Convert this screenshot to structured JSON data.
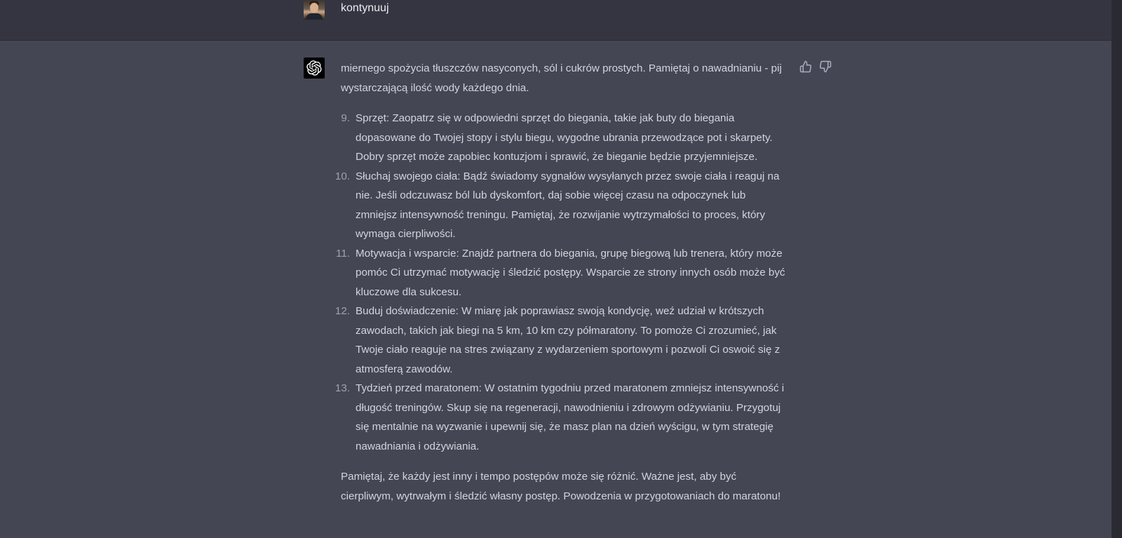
{
  "user_message": {
    "text": "kontynuuj"
  },
  "assistant_message": {
    "intro": "miernego spożycia tłuszczów nasyconych, sól i cukrów prostych. Pamiętaj o nawadnianiu - pij wystarczającą ilość wody każdego dnia.",
    "items": [
      {
        "num": "9.",
        "text": "Sprzęt: Zaopatrz się w odpowiedni sprzęt do biegania, takie jak buty do biegania dopasowane do Twojej stopy i stylu biegu, wygodne ubrania przewodzące pot i skarpety. Dobry sprzęt może zapobiec kontuzjom i sprawić, że bieganie będzie przyjemniejsze."
      },
      {
        "num": "10.",
        "text": "Słuchaj swojego ciała: Bądź świadomy sygnałów wysyłanych przez swoje ciała i reaguj na nie. Jeśli odczuwasz ból lub dyskomfort, daj sobie więcej czasu na odpoczynek lub zmniejsz intensywność treningu. Pamiętaj, że rozwijanie wytrzymałości to proces, który wymaga cierpliwości."
      },
      {
        "num": "11.",
        "text": "Motywacja i wsparcie: Znajdź partnera do biegania, grupę biegową lub trenera, który może pomóc Ci utrzymać motywację i śledzić postępy. Wsparcie ze strony innych osób może być kluczowe dla sukcesu."
      },
      {
        "num": "12.",
        "text": "Buduj doświadczenie: W miarę jak poprawiasz swoją kondycję, weź udział w krótszych zawodach, takich jak biegi na 5 km, 10 km czy półmaratony. To pomoże Ci zrozumieć, jak Twoje ciało reaguje na stres związany z wydarzeniem sportowym i pozwoli Ci oswoić się z atmosferą zawodów."
      },
      {
        "num": "13.",
        "text": "Tydzień przed maratonem: W ostatnim tygodniu przed maratonem zmniejsz intensywność i długość treningów. Skup się na regeneracji, nawodnieniu i zdrowym odżywianiu. Przygotuj się mentalnie na wyzwanie i upewnij się, że masz plan na dzień wyścigu, w tym strategię nawadniania i odżywiania."
      }
    ],
    "outro": "Pamiętaj, że każdy jest inny i tempo postępów może się różnić. Ważne jest, aby być cierpliwym, wytrwałym i śledzić własny postęp. Powodzenia w przygotowaniach do maratonu!"
  },
  "icons": {
    "assistant_logo": "openai-logo-icon",
    "thumbs_up": "thumbs-up-icon",
    "thumbs_down": "thumbs-down-icon"
  },
  "colors": {
    "user_row_bg": "#343541",
    "assistant_row_bg": "#444654",
    "text": "#d1d5db",
    "assistant_avatar_bg": "#000000"
  }
}
